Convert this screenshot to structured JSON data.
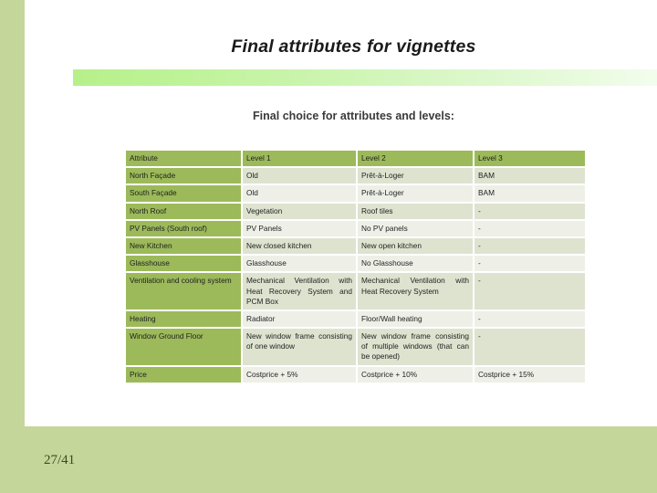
{
  "slide": {
    "title": "Final attributes for vignettes",
    "subtitle": "Final choice for attributes and levels:",
    "page_number": "27/41",
    "colors": {
      "background": "#c5d69a",
      "panel": "#ffffff",
      "header_green": "#9cba5a",
      "row_band_a": "#dde3cf",
      "row_band_b": "#eef0e8",
      "rule_start": "#b6f08a",
      "rule_end": "#f3fdee"
    }
  },
  "table": {
    "headers": [
      "Attribute",
      "Level 1",
      "Level 2",
      "Level 3"
    ],
    "rows": [
      {
        "attribute": "North Façade",
        "level1": "Old",
        "level2": "Prêt-à-Loger",
        "level3": "BAM"
      },
      {
        "attribute": "South Façade",
        "level1": "Old",
        "level2": "Prêt-à-Loger",
        "level3": "BAM"
      },
      {
        "attribute": "North Roof",
        "level1": "Vegetation",
        "level2": "Roof tiles",
        "level3": "-"
      },
      {
        "attribute": "PV Panels (South roof)",
        "level1": "PV Panels",
        "level2": "No PV panels",
        "level3": "-"
      },
      {
        "attribute": "New Kitchen",
        "level1": "New closed kitchen",
        "level2": "New open kitchen",
        "level3": "-"
      },
      {
        "attribute": "Glasshouse",
        "level1": "Glasshouse",
        "level2": "No Glasshouse",
        "level3": "-"
      },
      {
        "attribute": "Ventilation and cooling system",
        "level1": "Mechanical Ventilation with Heat Recovery System and PCM Box",
        "level2": "Mechanical Ventilation with Heat Recovery System",
        "level3": "-"
      },
      {
        "attribute": "Heating",
        "level1": "Radiator",
        "level2": "Floor/Wall heating",
        "level3": "-"
      },
      {
        "attribute": "Window Ground Floor",
        "level1": "New window frame consisting of one window",
        "level2": "New window frame consisting of multiple windows (that can be opened)",
        "level3": "-"
      },
      {
        "attribute": "Price",
        "level1": "Costprice + 5%",
        "level2": "Costprice + 10%",
        "level3": "Costprice + 15%"
      }
    ]
  }
}
